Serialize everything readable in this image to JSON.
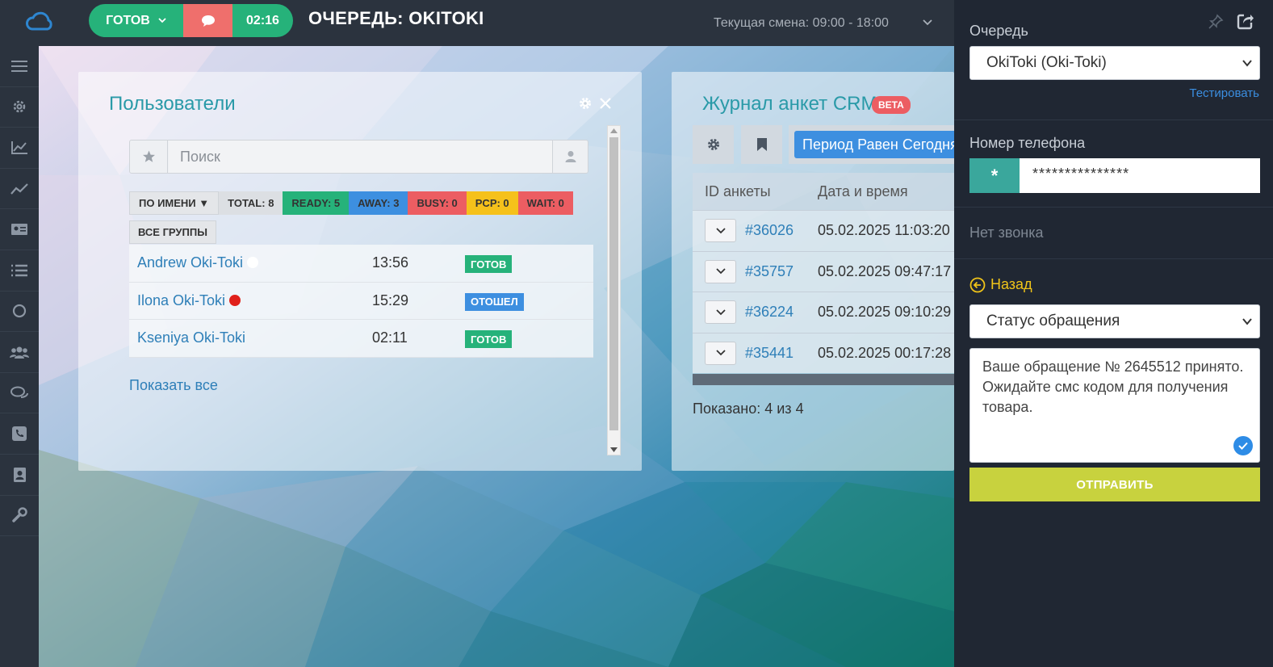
{
  "topbar": {
    "status_label": "ГОТОВ",
    "timer": "02:16",
    "queue_title": "ОЧЕРЕДЬ: OKITOKI",
    "shift": "Текущая смена: 09:00 - 18:00"
  },
  "users_panel": {
    "title": "Пользователи",
    "search_placeholder": "Поиск",
    "filters": {
      "sort": "ПО ИМЕНИ ▼",
      "total": "TOTAL: 8",
      "ready": "READY: 5",
      "away": "AWAY: 3",
      "busy": "BUSY: 0",
      "pcp": "PCP: 0",
      "wait": "WAIT: 0"
    },
    "groups_label": "ВСЕ ГРУППЫ",
    "users": [
      {
        "name": "Andrew Oki-Toki",
        "time": "13:56",
        "status": "ГОТОВ",
        "dot_color": "#ffffff",
        "badge_color": "#26b27a"
      },
      {
        "name": "Ilona Oki-Toki",
        "time": "15:29",
        "status": "ОТОШЕЛ",
        "dot_color": "#e0201b",
        "badge_color": "#3d8fe0"
      },
      {
        "name": "Kseniya Oki-Toki",
        "time": "02:11",
        "status": "ГОТОВ",
        "dot_color": null,
        "badge_color": "#26b27a"
      }
    ],
    "show_all": "Показать все"
  },
  "crm_panel": {
    "title": "Журнал анкет CRM",
    "beta": "BETA",
    "period_filter": "Период Равен Сегодня",
    "columns": {
      "id": "ID анкеты",
      "date": "Дата и время"
    },
    "rows": [
      {
        "id": "#36026",
        "date": "05.02.2025 11:03:20"
      },
      {
        "id": "#35757",
        "date": "05.02.2025 09:47:17"
      },
      {
        "id": "#36224",
        "date": "05.02.2025 09:10:29"
      },
      {
        "id": "#35441",
        "date": "05.02.2025 00:17:28"
      }
    ],
    "shown": "Показано: 4 из 4"
  },
  "right_panel": {
    "queue_label": "Очередь",
    "queue_value": "OkiToki (Oki-Toki)",
    "test_link": "Тестировать",
    "phone_label": "Номер телефона",
    "phone_prefix": "*",
    "phone_value": "***************",
    "no_call": "Нет звонка",
    "back": "Назад",
    "status_select": "Статус обращения",
    "message": "Ваше обращение № 2645512 принято. Ожидайте смс кодом для получения товара.",
    "send": "ОТПРАВИТЬ"
  },
  "colors": {
    "ready": "#26b27a",
    "away": "#3d8fe0",
    "busy": "#ec5d62",
    "pcp": "#f5c11b",
    "wait": "#ec5d62",
    "accent_teal": "#2a9aa8",
    "send_button": "#c8d23e"
  }
}
